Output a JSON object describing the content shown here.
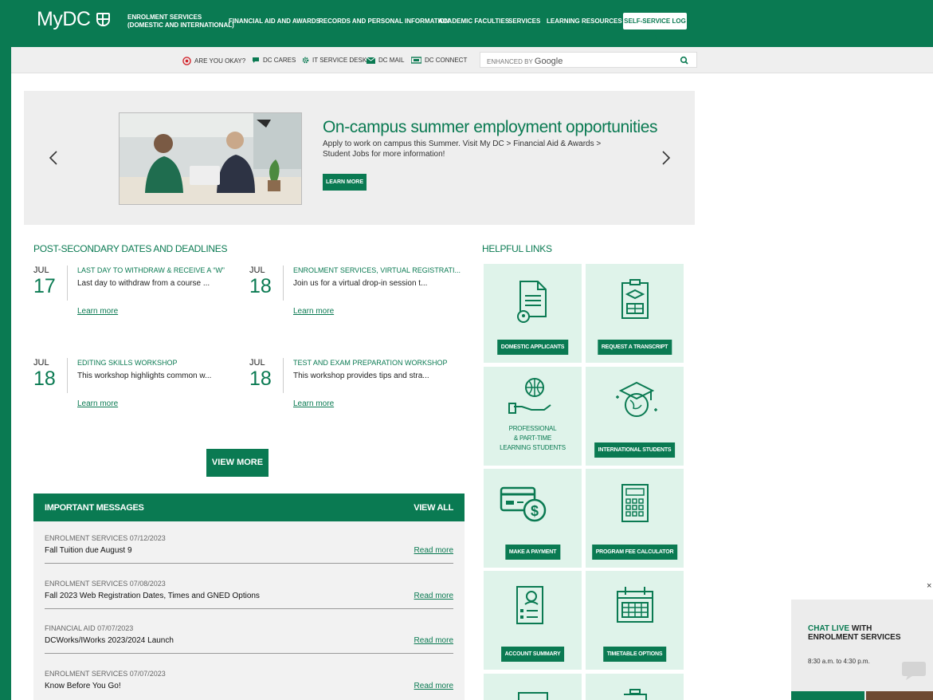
{
  "brand": {
    "logo_text": "MyDC",
    "primary_color": "#0a7a52"
  },
  "topnav": {
    "enrolment_line1": "ENROLMENT SERVICES",
    "enrolment_line2": "(DOMESTIC AND INTERNATIONAL)",
    "financial": "FINANCIAL AID AND AWARDS",
    "records": "RECORDS AND PERSONAL INFORMATION",
    "academic": "ACADEMIC FACULTIES",
    "services": "SERVICES",
    "learning": "LEARNING RESOURCES",
    "login": "SELF-SERVICE LOG IN"
  },
  "utility": {
    "okay": "ARE YOU OKAY?",
    "cares": "DC CARES",
    "it": "IT SERVICE DESK",
    "mail": "DC MAIL",
    "connect": "DC CONNECT",
    "search_prefix": "ENHANCED BY",
    "search_brand": "Google"
  },
  "hero": {
    "title": "On-campus summer employment opportunities",
    "text": "Apply to work on campus this Summer. Visit My DC > Financial Aid & Awards > Student Jobs for more information!",
    "button": "LEARN MORE"
  },
  "dates": {
    "title": "POST-SECONDARY DATES AND DEADLINES",
    "events": [
      {
        "month": "JUL",
        "day": "17",
        "title": "LAST DAY TO WITHDRAW & RECEIVE A “W”",
        "desc": "Last day to withdraw from a course ...",
        "link": "Learn more"
      },
      {
        "month": "JUL",
        "day": "18",
        "title": "ENROLMENT SERVICES, VIRTUAL REGISTRATI...",
        "desc": "Join us for a virtual drop-in session t...",
        "link": "Learn more"
      },
      {
        "month": "JUL",
        "day": "18",
        "title": "EDITING SKILLS WORKSHOP",
        "desc": "This workshop highlights common w...",
        "link": "Learn more"
      },
      {
        "month": "JUL",
        "day": "18",
        "title": "TEST AND EXAM PREPARATION WORKSHOP",
        "desc": "This workshop provides tips and stra...",
        "link": "Learn more"
      }
    ],
    "view_more": "VIEW MORE"
  },
  "messages": {
    "title": "IMPORTANT MESSAGES",
    "view_all": "VIEW ALL",
    "items": [
      {
        "meta": "ENROLMENT SERVICES   07/12/2023",
        "title": "Fall Tuition due August 9",
        "link": "Read more"
      },
      {
        "meta": "ENROLMENT SERVICES   07/08/2023",
        "title": "Fall 2023 Web Registration Dates, Times and GNED Options",
        "link": "Read more"
      },
      {
        "meta": "FINANCIAL AID   07/07/2023",
        "title": "DCWorks/IWorks 2023/2024 Launch",
        "link": "Read more"
      },
      {
        "meta": "ENROLMENT SERVICES   07/07/2023",
        "title": "Know Before You Go!",
        "link": "Read more"
      }
    ]
  },
  "helpful": {
    "title": "HELPFUL LINKS",
    "tiles": [
      {
        "label": "DOMESTIC APPLICANTS",
        "icon": "document-location-icon"
      },
      {
        "label": "REQUEST A TRANSCRIPT",
        "icon": "transcript-icon"
      },
      {
        "label": "PROFESSIONAL\n& PART-TIME\nLEARNING STUDENTS",
        "icon": "globe-hand-icon"
      },
      {
        "label": "INTERNATIONAL STUDENTS",
        "icon": "globe-grad-cap-icon"
      },
      {
        "label": "MAKE A PAYMENT",
        "icon": "credit-card-dollar-icon"
      },
      {
        "label": "PROGRAM FEE CALCULATOR",
        "icon": "calculator-icon"
      },
      {
        "label": "ACCOUNT SUMMARY",
        "icon": "account-summary-icon"
      },
      {
        "label": "TIMETABLE OPTIONS",
        "icon": "calendar-grid-icon"
      }
    ]
  },
  "chat": {
    "title_accent": "CHAT LIVE",
    "title_rest": " WITH",
    "title_line2": "ENROLMENT SERVICES",
    "hours": "8:30 a.m. to 4:30 p.m.",
    "close": "×"
  }
}
